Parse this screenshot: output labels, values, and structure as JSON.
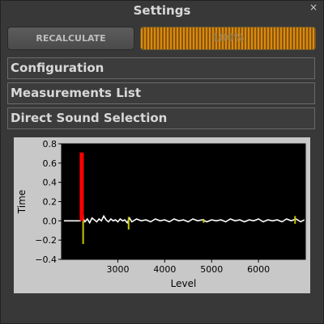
{
  "window": {
    "title": "Settings"
  },
  "toolbar": {
    "recalculate_label": "RECALCULATE"
  },
  "progress": {
    "value": 1.0,
    "label": "100%"
  },
  "sections": [
    {
      "label": "Configuration"
    },
    {
      "label": "Measurements List"
    },
    {
      "label": "Direct Sound Selection"
    }
  ],
  "colors": {
    "accent": "#d98a10",
    "panel": "#383838",
    "plot_background": "#000000",
    "impulse": "#ff0000",
    "marker": "#c8c800",
    "trace": "#ffffff"
  },
  "chart_data": {
    "type": "line",
    "xlabel": "Level",
    "ylabel": "Time",
    "xlim": [
      1800,
      7000
    ],
    "ylim": [
      -0.4,
      0.8
    ],
    "xticks": [
      3000,
      4000,
      5000,
      6000
    ],
    "xtick_labels": [
      "3000",
      "4000",
      "5000",
      "6000"
    ],
    "yticks": [
      -0.4,
      -0.2,
      0.0,
      0.2,
      0.4,
      0.6,
      0.8
    ],
    "ytick_labels": [
      "−0.4",
      "−0.2",
      "0.0",
      "0.2",
      "0.4",
      "0.6",
      "0.8"
    ],
    "grid": false,
    "impulse": {
      "x": 2230,
      "y0": 0.0,
      "y1": 0.71
    },
    "marker_spikes": [
      {
        "x": 2260,
        "y0": -0.24,
        "y1": 0.06
      },
      {
        "x": 3230,
        "y0": -0.09,
        "y1": 0.04
      },
      {
        "x": 4830,
        "y0": -0.02,
        "y1": 0.02
      },
      {
        "x": 6780,
        "y0": -0.03,
        "y1": 0.05
      }
    ],
    "trace": [
      [
        1850,
        0.0
      ],
      [
        1950,
        0.0
      ],
      [
        2050,
        0.0
      ],
      [
        2150,
        0.0
      ],
      [
        2200,
        0.0
      ],
      [
        2240,
        0.04
      ],
      [
        2300,
        -0.01
      ],
      [
        2350,
        0.02
      ],
      [
        2400,
        -0.02
      ],
      [
        2450,
        0.03
      ],
      [
        2500,
        0.01
      ],
      [
        2550,
        -0.01
      ],
      [
        2600,
        0.02
      ],
      [
        2650,
        0.0
      ],
      [
        2700,
        0.05
      ],
      [
        2750,
        0.01
      ],
      [
        2800,
        -0.01
      ],
      [
        2850,
        0.02
      ],
      [
        2900,
        0.0
      ],
      [
        2950,
        0.01
      ],
      [
        3000,
        -0.01
      ],
      [
        3050,
        0.02
      ],
      [
        3100,
        0.0
      ],
      [
        3150,
        0.01
      ],
      [
        3200,
        -0.02
      ],
      [
        3250,
        0.03
      ],
      [
        3300,
        -0.01
      ],
      [
        3400,
        0.02
      ],
      [
        3500,
        0.0
      ],
      [
        3600,
        0.01
      ],
      [
        3700,
        -0.01
      ],
      [
        3800,
        0.02
      ],
      [
        3900,
        0.0
      ],
      [
        4000,
        0.01
      ],
      [
        4100,
        -0.01
      ],
      [
        4200,
        0.02
      ],
      [
        4300,
        0.0
      ],
      [
        4400,
        0.01
      ],
      [
        4500,
        -0.01
      ],
      [
        4600,
        0.02
      ],
      [
        4700,
        0.0
      ],
      [
        4800,
        0.01
      ],
      [
        4900,
        -0.01
      ],
      [
        5000,
        0.01
      ],
      [
        5100,
        0.0
      ],
      [
        5200,
        0.01
      ],
      [
        5300,
        -0.01
      ],
      [
        5400,
        0.02
      ],
      [
        5500,
        0.0
      ],
      [
        5600,
        0.01
      ],
      [
        5700,
        -0.01
      ],
      [
        5800,
        0.01
      ],
      [
        5900,
        0.0
      ],
      [
        6000,
        0.02
      ],
      [
        6100,
        -0.01
      ],
      [
        6200,
        0.01
      ],
      [
        6300,
        0.0
      ],
      [
        6400,
        0.01
      ],
      [
        6500,
        -0.01
      ],
      [
        6600,
        0.02
      ],
      [
        6700,
        0.0
      ],
      [
        6800,
        0.02
      ],
      [
        6900,
        -0.01
      ],
      [
        6980,
        0.01
      ]
    ]
  }
}
